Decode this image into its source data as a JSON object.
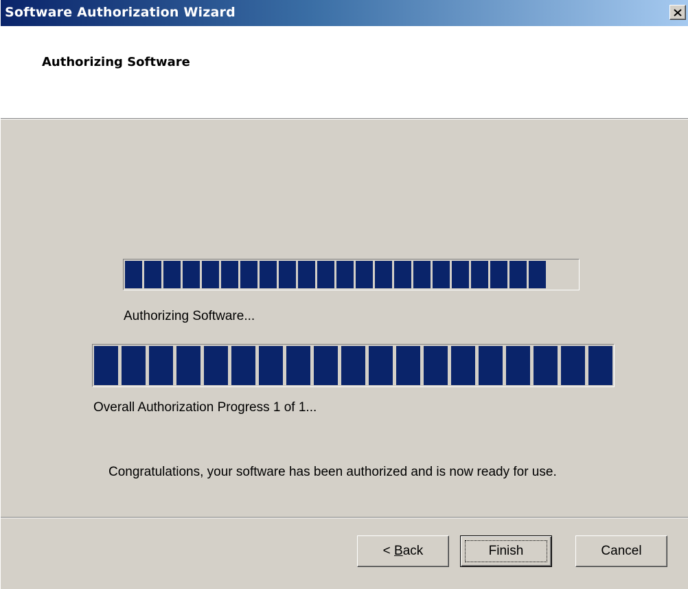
{
  "window": {
    "title": "Software Authorization Wizard",
    "close_icon": "close-icon",
    "colors": {
      "titlebar_start": "#0a246a",
      "titlebar_end": "#a6caf0",
      "face": "#d4d0c8",
      "progress_fill": "#0a246a"
    }
  },
  "header": {
    "title": "Authorizing Software"
  },
  "progress": {
    "current": {
      "label": "Authorizing Software...",
      "value": 0.95
    },
    "overall": {
      "label": "Overall Authorization Progress 1 of 1...",
      "value": 1.0
    }
  },
  "message": "Congratulations, your software has been authorized and is now ready for use.",
  "buttons": {
    "back": {
      "prefix": "< ",
      "mnemonic": "B",
      "rest": "ack"
    },
    "finish": "Finish",
    "cancel": "Cancel"
  }
}
